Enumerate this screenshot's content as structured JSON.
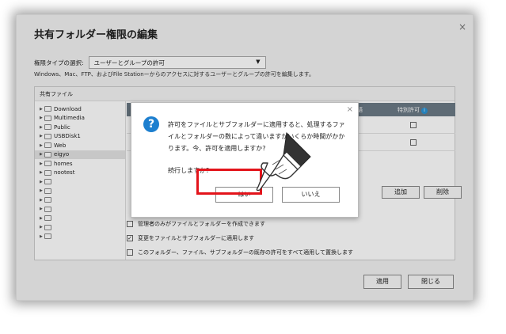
{
  "window": {
    "title": "共有フォルダー権限の編集",
    "close_glyph": "×"
  },
  "permission_type": {
    "label": "権限タイプの選択:",
    "selected": "ユーザーとグループの許可",
    "arrow": "▼"
  },
  "description": "Windows、Mac、FTP、およびFile Stationーからのアクセスに対するユーザーとグループの許可を編集します。",
  "shared_files": {
    "header": "共有ファイル",
    "tree": [
      {
        "label": "Download",
        "selected": false
      },
      {
        "label": "Multimedia",
        "selected": false
      },
      {
        "label": "Public",
        "selected": false
      },
      {
        "label": "USBDisk1",
        "selected": false
      },
      {
        "label": "Web",
        "selected": false
      },
      {
        "label": "eigyo",
        "selected": true
      },
      {
        "label": "homes",
        "selected": false
      },
      {
        "label": "nootest",
        "selected": false
      },
      {
        "label": "",
        "selected": false
      },
      {
        "label": "",
        "selected": false
      },
      {
        "label": "",
        "selected": false
      },
      {
        "label": "",
        "selected": false
      },
      {
        "label": "",
        "selected": false
      },
      {
        "label": "",
        "selected": false
      },
      {
        "label": "",
        "selected": false
      }
    ],
    "columns": {
      "truncated": "語",
      "special": "特別許可",
      "info_glyph": "i"
    },
    "buttons": {
      "add": "追加",
      "delete": "削除"
    },
    "options": [
      {
        "label": "管理者のみがファイルとフォルダーを作成できます",
        "checked": false
      },
      {
        "label": "変更をファイルとサブフォルダーに適用します",
        "checked": true
      },
      {
        "label": "このフォルダー、ファイル、サブフォルダーの既存の許可をすべて適用して置換します",
        "checked": false
      }
    ]
  },
  "footer": {
    "apply": "適用",
    "close": "閉じる"
  },
  "dialog": {
    "icon_glyph": "?",
    "close_glyph": "×",
    "message": "許可をファイルとサブフォルダーに適用すると、処理するファイルとフォルダーの数によって違いますがいくらか時間がかかります。今、許可を適用しますか?",
    "confirm": "続行しますか?",
    "yes": "はい",
    "no": "いいえ"
  },
  "colors": {
    "highlight": "#e3141b",
    "header_bar": "#6b7a86",
    "question_icon": "#1d7fcf"
  }
}
